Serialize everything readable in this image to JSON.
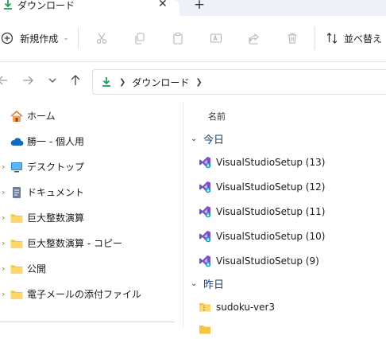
{
  "tab": {
    "title": "ダウンロード",
    "close": "✕",
    "new_tab": "+"
  },
  "toolbar": {
    "new_label": "新規作成",
    "sort_label": "並べ替え"
  },
  "address": {
    "crumb": "ダウンロード"
  },
  "sidebar": {
    "items": [
      {
        "label": "ホーム"
      },
      {
        "label": "勝一 - 個人用"
      },
      {
        "label": "デスクトップ"
      },
      {
        "label": "ドキュメント"
      },
      {
        "label": "巨大整数演算"
      },
      {
        "label": "巨大整数演算 - コピー"
      },
      {
        "label": "公開"
      },
      {
        "label": "電子メールの添付ファイル"
      }
    ]
  },
  "main": {
    "column_name": "名前",
    "groups": [
      {
        "label": "今日",
        "files": [
          {
            "name": "VisualStudioSetup (13)"
          },
          {
            "name": "VisualStudioSetup (12)"
          },
          {
            "name": "VisualStudioSetup (11)"
          },
          {
            "name": "VisualStudioSetup (10)"
          },
          {
            "name": "VisualStudioSetup (9)"
          }
        ]
      },
      {
        "label": "昨日",
        "files": [
          {
            "name": "sudoku-ver3"
          }
        ]
      }
    ]
  },
  "colors": {
    "accent": "#0067c0",
    "folder": "#f5c542",
    "vs_purple": "#7b4fc6",
    "download_green": "#1e9e54"
  }
}
